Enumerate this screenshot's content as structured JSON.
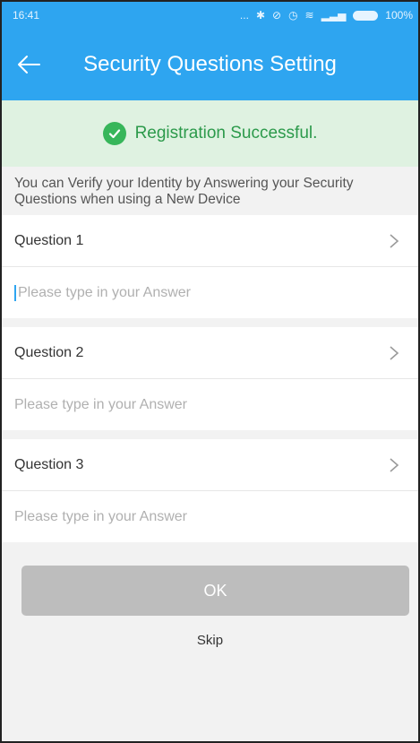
{
  "status_bar": {
    "time": "16:41",
    "icons": [
      "more-dots-icon",
      "bluetooth-icon",
      "alarm-off-icon",
      "alarm-icon",
      "wifi-icon",
      "signal-icon",
      "battery-icon"
    ],
    "dots": "...",
    "battery_percent": "100%"
  },
  "header": {
    "title": "Security Questions Setting",
    "back_icon": "back-arrow-icon"
  },
  "banner": {
    "icon": "check-circle-icon",
    "text": "Registration Successful."
  },
  "info": {
    "text": "You can Verify your Identity by Answering your Security Questions when using a New Device"
  },
  "questions": [
    {
      "label": "Question 1",
      "answer_placeholder": "Please type in your Answer",
      "answer_value": ""
    },
    {
      "label": "Question 2",
      "answer_placeholder": "Please type in your Answer",
      "answer_value": ""
    },
    {
      "label": "Question 3",
      "answer_placeholder": "Please type in your Answer",
      "answer_value": ""
    }
  ],
  "actions": {
    "ok_label": "OK",
    "skip_label": "Skip"
  },
  "colors": {
    "primary": "#2ea5f0",
    "success_bg": "#dff2e1",
    "success": "#37b65a",
    "button_disabled": "#bdbdbd"
  }
}
